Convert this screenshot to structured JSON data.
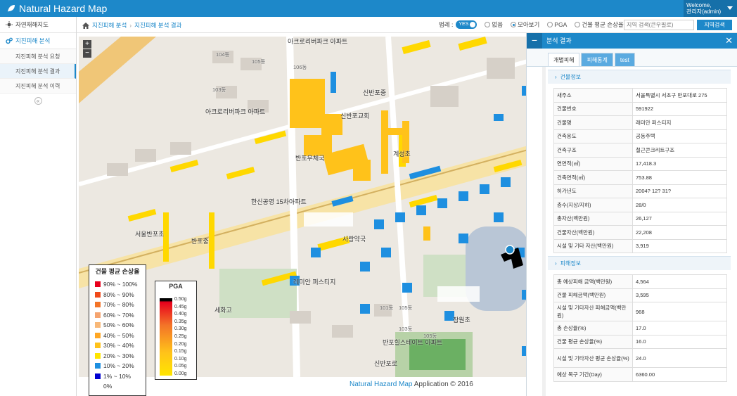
{
  "header": {
    "app_title": "Natural Hazard Map",
    "welcome": "Welcome,",
    "user": "관리자(admin)"
  },
  "sidebar": {
    "items": [
      {
        "label": "자연재해지도"
      },
      {
        "label": "지진피해 분석"
      }
    ],
    "subitems": [
      {
        "label": "지진피해 분석 요청"
      },
      {
        "label": "지진피해 분석 결과"
      },
      {
        "label": "지진피해 분석 이력"
      }
    ],
    "collapse": "«"
  },
  "toolbar": {
    "crumb1": "지진피해 분석",
    "crumb2": "지진피해 분석 결과",
    "legend_label": "범례 :",
    "toggle": "YES",
    "radio_none": "없음",
    "radio_cluster": "모아보기",
    "radio_pga": "PGA",
    "radio_loss": "건물 평균 손상율",
    "search_placeholder": "지역 검색(큰우필로)",
    "search_button": "지역검색"
  },
  "map": {
    "labels": [
      "아크로리버파크 아파트",
      "104동",
      "105동",
      "106동",
      "103동",
      "아크로리버파크 아파트",
      "신반포중",
      "신반포교회",
      "반포우체국",
      "계성초",
      "한신공영 15차아파트",
      "서울반포초",
      "반포중",
      "사랑약국",
      "레미안 퍼스티지",
      "세화고",
      "잠원초",
      "반포힐스테이트 아파트",
      "신반포로",
      "101동",
      "105동",
      "103동",
      "105동"
    ],
    "zoom_in": "+",
    "zoom_out": "−"
  },
  "loss_legend": {
    "title": "건물 평균 손상율",
    "items": [
      {
        "label": "90% ~ 100%",
        "color": "#e8001c"
      },
      {
        "label": "80% ~ 90%",
        "color": "#f04a1a"
      },
      {
        "label": "70% ~ 80%",
        "color": "#f37428"
      },
      {
        "label": "60% ~ 70%",
        "color": "#f5a46f"
      },
      {
        "label": "50% ~ 60%",
        "color": "#f8b878"
      },
      {
        "label": "40% ~ 50%",
        "color": "#ffa724"
      },
      {
        "label": "30% ~ 40%",
        "color": "#ffc21a"
      },
      {
        "label": "20% ~ 30%",
        "color": "#ffe500"
      },
      {
        "label": "10% ~ 20%",
        "color": "#1e8fe0"
      },
      {
        "label": "1% ~ 10%",
        "color": "#0000d0"
      },
      {
        "label": "0%",
        "color": "#ffffff"
      }
    ]
  },
  "pga_legend": {
    "title": "PGA",
    "values": [
      "0.50g",
      "0.45g",
      "0.40g",
      "0.35g",
      "0.30g",
      "0.25g",
      "0.20g",
      "0.15g",
      "0.10g",
      "0.05g",
      "0.00g"
    ]
  },
  "footer": {
    "brand": "Natural Hazard Map",
    "rest": " Application © 2016"
  },
  "panel": {
    "title": "분석 결과",
    "tabs": [
      "개별피해",
      "피해통계",
      "test"
    ],
    "section1": "건물정보",
    "building": [
      {
        "k": "새주소",
        "v": "서울특별시 서초구 반포대로 275"
      },
      {
        "k": "건물번호",
        "v": "591922"
      },
      {
        "k": "건물명",
        "v": "래미안 퍼스티지"
      },
      {
        "k": "건축용도",
        "v": "공동주택"
      },
      {
        "k": "건축구조",
        "v": "철근콘크리트구조"
      },
      {
        "k": "연면적(㎡)",
        "v": "17,418.3"
      },
      {
        "k": "건축면적(㎡)",
        "v": "753.88"
      },
      {
        "k": "허가년도",
        "v": "2004? 12? 31?"
      },
      {
        "k": "층수(지상/지하)",
        "v": "28/0"
      },
      {
        "k": "총자산(백만원)",
        "v": "26,127"
      },
      {
        "k": "건물자산(백만원)",
        "v": "22,208"
      },
      {
        "k": "시설 및 기타 자산(백만원)",
        "v": "3,919"
      }
    ],
    "section2": "피해정보",
    "damage": [
      {
        "k": "총 예상피해 금액(백만원)",
        "v": "4,564"
      },
      {
        "k": "건물 피해금액(백만원)",
        "v": "3,595"
      },
      {
        "k": "시설 및 기타자산 피해금액(백만원)",
        "v": "968"
      },
      {
        "k": "총 손상율(%)",
        "v": "17.0"
      },
      {
        "k": "건물 평균 손상율(%)",
        "v": "16.0"
      },
      {
        "k": "시설 및 기타자산 평균 손상율(%)",
        "v": "24.0"
      },
      {
        "k": "예상 복구 기간(Day)",
        "v": "6360.00"
      }
    ]
  }
}
